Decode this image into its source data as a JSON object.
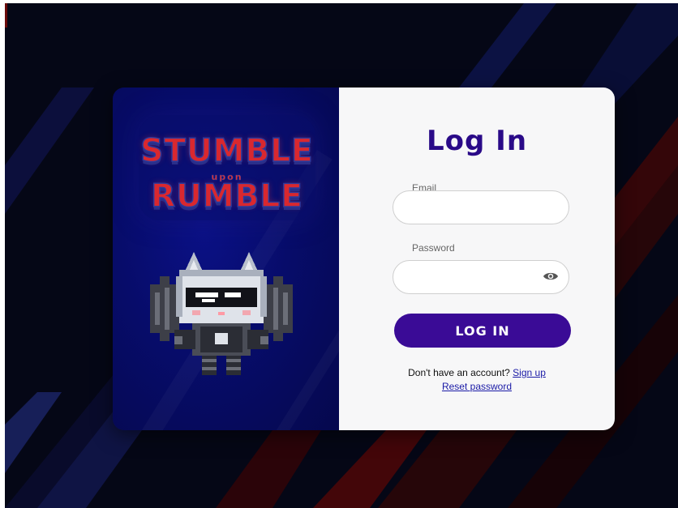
{
  "colors": {
    "background": "#050716",
    "panel_left": "#070c6a",
    "panel_right": "#f7f7f8",
    "accent": "#3a0b96",
    "title": "#2a0a88",
    "link": "#1a1aa6",
    "logo_red": "#d9282f"
  },
  "logo": {
    "line1": "STUMBLE",
    "line2": "upon",
    "line3": "RUMBLE"
  },
  "mascot": {
    "icon": "pixel-cat-mascot-icon"
  },
  "form": {
    "title": "Log In",
    "email_label": "Email",
    "email_value": "",
    "email_placeholder": "",
    "password_label": "Password",
    "password_value": "",
    "password_placeholder": "",
    "password_toggle_icon": "eye-icon",
    "submit_label": "LOG IN",
    "signup_prompt": "Don't have an account?",
    "signup_link": "Sign up",
    "reset_link": "Reset password"
  }
}
